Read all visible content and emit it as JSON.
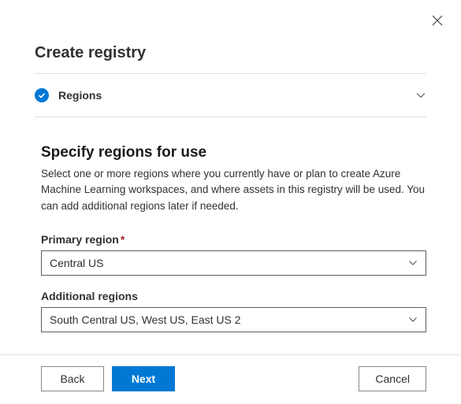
{
  "dialog": {
    "title": "Create registry"
  },
  "section": {
    "label": "Regions"
  },
  "content": {
    "heading": "Specify regions for use",
    "description": "Select one or more regions where you currently have or plan to create Azure Machine Learning workspaces, and where assets in this registry will be used. You can add additional regions later if needed."
  },
  "fields": {
    "primary": {
      "label": "Primary region",
      "value": "Central US"
    },
    "additional": {
      "label": "Additional regions",
      "value": "South Central US, West US, East US 2"
    }
  },
  "buttons": {
    "back": "Back",
    "next": "Next",
    "cancel": "Cancel"
  }
}
